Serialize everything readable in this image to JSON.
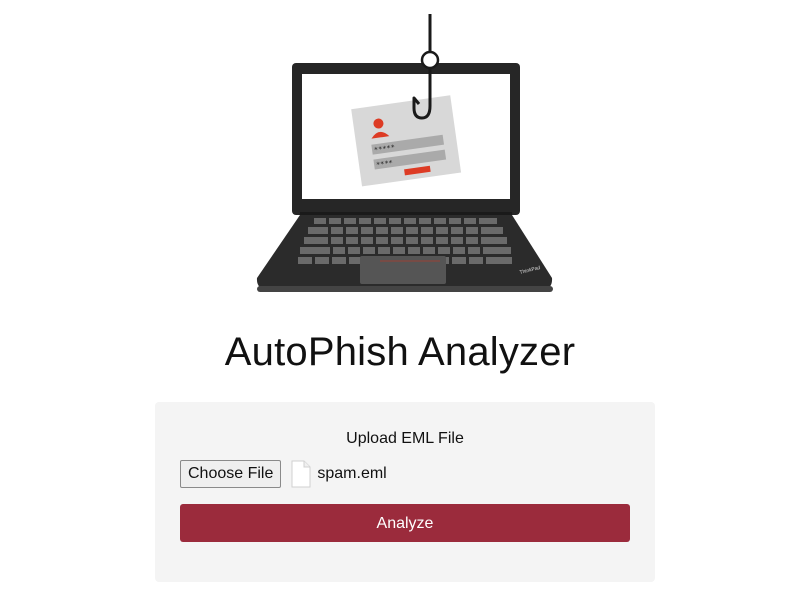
{
  "hero": {
    "image_icon": "laptop-phishing-hook-icon",
    "brand_mark": "ThinkPad"
  },
  "page": {
    "title": "AutoPhish Analyzer"
  },
  "upload": {
    "label": "Upload EML File",
    "choose_button": "Choose File",
    "file_icon": "document-icon",
    "file_name": "spam.eml",
    "analyze_button": "Analyze"
  },
  "colors": {
    "accent": "#9b2b3c",
    "card_background": "#f4f4f4",
    "laptop_body": "#262626",
    "login_card_accent": "#dd3b24"
  }
}
